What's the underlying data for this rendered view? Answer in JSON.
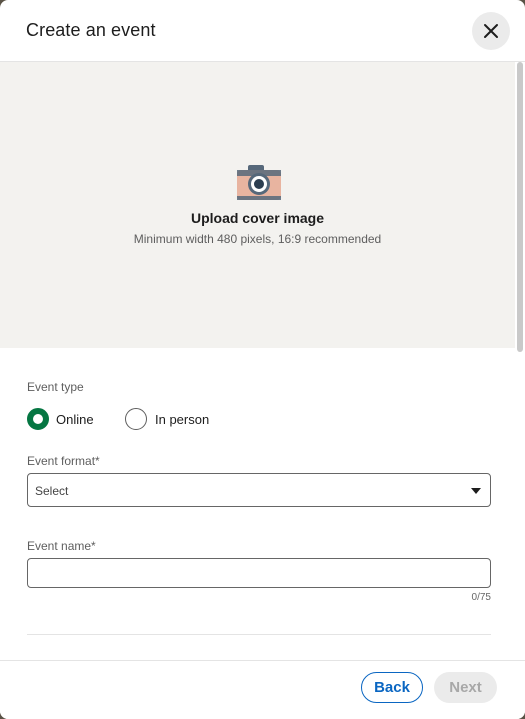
{
  "dialog": {
    "title": "Create an event",
    "close_label": "Close"
  },
  "cover": {
    "title": "Upload cover image",
    "subtitle": "Minimum width 480 pixels, 16:9 recommended",
    "icon": "camera-icon"
  },
  "event_type": {
    "label": "Event type",
    "options": [
      {
        "label": "Online",
        "selected": true
      },
      {
        "label": "In person",
        "selected": false
      }
    ]
  },
  "event_format": {
    "label": "Event format*",
    "selected": "Select"
  },
  "event_name": {
    "label": "Event name*",
    "value": "",
    "counter": "0/75"
  },
  "footer": {
    "back_label": "Back",
    "next_label": "Next"
  },
  "colors": {
    "accent": "#0a66c2",
    "radio_selected": "#057642",
    "cover_bg": "#f3f2ef"
  }
}
